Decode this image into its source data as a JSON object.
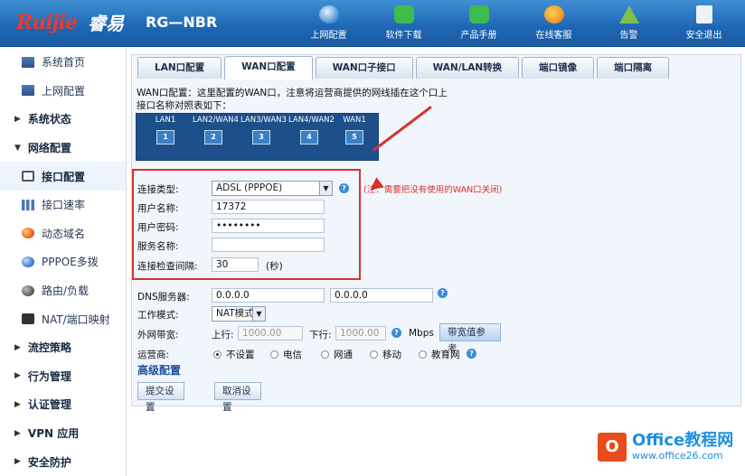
{
  "header": {
    "brand_logo": "Ruijie",
    "brand_sub": "睿易",
    "model": "RG—NBR",
    "nav": [
      {
        "label": "上网配置",
        "icon": "globe-icon"
      },
      {
        "label": "软件下载",
        "icon": "download-icon"
      },
      {
        "label": "产品手册",
        "icon": "manual-icon"
      },
      {
        "label": "在线客服",
        "icon": "support-icon"
      },
      {
        "label": "告警",
        "icon": "alert-icon"
      },
      {
        "label": "安全退出",
        "icon": "logout-icon"
      }
    ]
  },
  "sidebar": {
    "items": [
      {
        "label": "系统首页",
        "type": "sub"
      },
      {
        "label": "上网配置",
        "type": "sub"
      },
      {
        "label": "系统状态",
        "type": "group",
        "arrow": "▶"
      },
      {
        "label": "网络配置",
        "type": "group",
        "arrow": "▼"
      },
      {
        "label": "接口配置",
        "type": "sub",
        "active": true
      },
      {
        "label": "接口速率",
        "type": "sub"
      },
      {
        "label": "动态域名",
        "type": "sub"
      },
      {
        "label": "PPPOE多拨",
        "type": "sub"
      },
      {
        "label": "路由/负载",
        "type": "sub"
      },
      {
        "label": "NAT/端口映射",
        "type": "sub"
      },
      {
        "label": "流控策略",
        "type": "group",
        "arrow": "▶"
      },
      {
        "label": "行为管理",
        "type": "group",
        "arrow": "▶"
      },
      {
        "label": "认证管理",
        "type": "group",
        "arrow": "▶"
      },
      {
        "label": "VPN 应用",
        "type": "group",
        "arrow": "▶"
      },
      {
        "label": "安全防护",
        "type": "group",
        "arrow": "▶"
      }
    ]
  },
  "tabs": [
    "LAN口配置",
    "WAN口配置",
    "WAN口子接口",
    "WAN/LAN转换",
    "端口镜像",
    "端口隔离"
  ],
  "intro": {
    "line1": "WAN口配置：这里配置的WAN口，注意将运营商提供的网线插在这个口上",
    "line2": "接口名称对照表如下："
  },
  "ports": [
    {
      "label": "LAN1",
      "num": "1"
    },
    {
      "label": "LAN2/WAN4",
      "num": "2"
    },
    {
      "label": "LAN3/WAN3",
      "num": "3"
    },
    {
      "label": "LAN4/WAN2",
      "num": "4"
    },
    {
      "label": "WAN1",
      "num": "5"
    }
  ],
  "form": {
    "conn_type_label": "连接类型:",
    "conn_type_value": "ADSL (PPPOE)",
    "note": "(注：需要把没有使用的WAN口关闭)",
    "username_label": "用户名称:",
    "username_value": "17372",
    "password_label": "用户密码:",
    "password_value": "••••••••",
    "service_label": "服务名称:",
    "service_value": "",
    "interval_label": "连接检查间隔:",
    "interval_value": "30",
    "interval_unit": "(秒)",
    "dns_label": "DNS服务器:",
    "dns1": "0.0.0.0",
    "dns2": "0.0.0.0",
    "mode_label": "工作模式:",
    "mode_value": "NAT模式",
    "bandwidth_label": "外网带宽:",
    "up_label": "上行:",
    "up_value": "1000.00",
    "down_label": "下行:",
    "down_value": "1000.00",
    "unit": "Mbps",
    "bw_ref_button": "带宽值参考",
    "isp_label": "运营商:",
    "isp_options": [
      "不设置",
      "电信",
      "网通",
      "移动",
      "教育网"
    ],
    "advanced": "高级配置",
    "submit": "提交设置",
    "cancel": "取消设置"
  },
  "watermark": {
    "logo": "O",
    "title": "Office教程网",
    "url": "www.office26.com"
  },
  "colors": {
    "header": "#1e66b4",
    "highlight": "#d9302f",
    "port_map": "#1d4f8a"
  }
}
